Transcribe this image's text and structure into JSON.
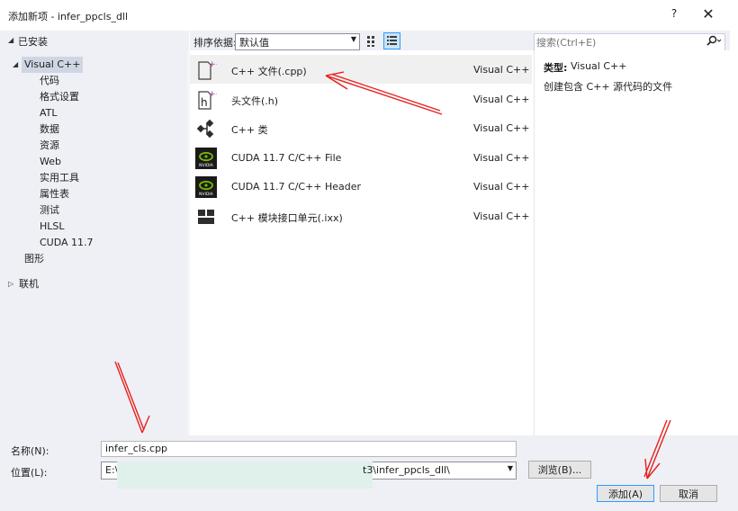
{
  "window": {
    "title": "添加新项 - infer_ppcls_dll",
    "help_label": "?",
    "close_label": "✕"
  },
  "left": {
    "header": "已安装",
    "root_label": "Visual C++",
    "children": [
      "代码",
      "格式设置",
      "ATL",
      "数据",
      "资源",
      "Web",
      "实用工具",
      "属性表",
      "测试",
      "HLSL",
      "CUDA 11.7"
    ],
    "sibling_label": "图形",
    "online_label": "联机"
  },
  "toolbar": {
    "sort_label": "排序依据:",
    "sort_value": "默认值",
    "search_placeholder": "搜索(Ctrl+E)"
  },
  "templates": [
    {
      "name": "C++ 文件(.cpp)",
      "lang": "Visual C++",
      "icon": "cpp-file-icon",
      "selected": true
    },
    {
      "name": "头文件(.h)",
      "lang": "Visual C++",
      "icon": "header-file-icon",
      "selected": false
    },
    {
      "name": "C++ 类",
      "lang": "Visual C++",
      "icon": "class-icon",
      "selected": false
    },
    {
      "name": "CUDA 11.7 C/C++ File",
      "lang": "Visual C++",
      "icon": "nvidia-icon",
      "selected": false
    },
    {
      "name": "CUDA 11.7 C/C++ Header",
      "lang": "Visual C++",
      "icon": "nvidia-icon",
      "selected": false
    },
    {
      "name": "C++ 模块接口单元(.ixx)",
      "lang": "Visual C++",
      "icon": "module-icon",
      "selected": false
    }
  ],
  "nvidia_logo_text": "NVIDIA",
  "description": {
    "type_label": "类型:",
    "type_value": "Visual C++",
    "text": "创建包含 C++ 源代码的文件"
  },
  "bottom": {
    "name_label": "名称(N):",
    "name_value": "infer_cls.cpp",
    "location_label": "位置(L):",
    "location_prefix": "E:\\",
    "location_suffix": "t3\\infer_ppcls_dll\\",
    "browse_label": "浏览(B)...",
    "add_label": "添加(A)",
    "cancel_label": "取消"
  },
  "colors": {
    "accent": "#3399ff",
    "annotation_red": "#e8201c",
    "nvidia_green": "#76b900"
  }
}
